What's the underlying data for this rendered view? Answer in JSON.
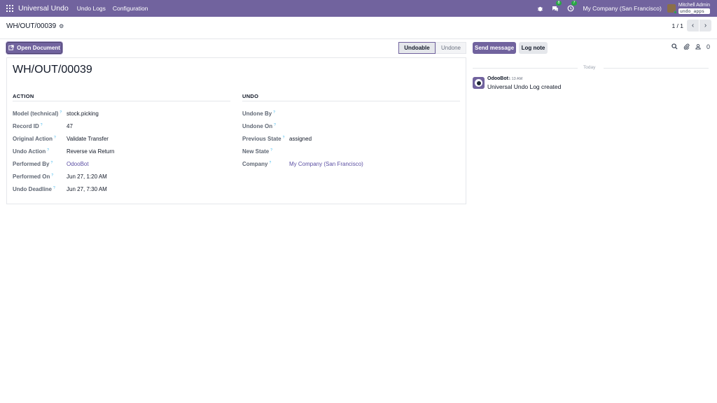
{
  "navbar": {
    "app_name": "Universal Undo",
    "menu": [
      "Undo Logs",
      "Configuration"
    ],
    "messages_count": "8",
    "activities_count": "7",
    "company": "My Company (San Francisco)",
    "user_name": "Mitchell Admin",
    "db_name": "undo_apps"
  },
  "control": {
    "breadcrumb": "WH/OUT/00039",
    "pager": "1 / 1"
  },
  "actions": {
    "open_document": "Open Document"
  },
  "status": {
    "stages": [
      "Undoable",
      "Undone"
    ],
    "current": "Undoable"
  },
  "record": {
    "title": "WH/OUT/00039",
    "action_group": {
      "title": "ACTION",
      "fields": [
        {
          "label": "Model (technical)",
          "value": "stock.picking"
        },
        {
          "label": "Record ID",
          "value": "47"
        },
        {
          "label": "Original Action",
          "value": "Validate Transfer"
        },
        {
          "label": "Undo Action",
          "value": "Reverse via Return"
        },
        {
          "label": "Performed By",
          "value": "OdooBot"
        },
        {
          "label": "Performed On",
          "value": "Jun 27, 1:20 AM"
        },
        {
          "label": "Undo Deadline",
          "value": "Jun 27, 7:30 AM"
        }
      ]
    },
    "undo_group": {
      "title": "UNDO",
      "fields": [
        {
          "label": "Undone By",
          "value": ""
        },
        {
          "label": "Undone On",
          "value": ""
        },
        {
          "label": "Previous State",
          "value": "assigned"
        },
        {
          "label": "New State",
          "value": ""
        },
        {
          "label": "Company",
          "value": "My Company (San Francisco)"
        }
      ]
    },
    "help_mark": "?"
  },
  "chatter": {
    "send_message": "Send message",
    "log_note": "Log note",
    "followers_count": "0",
    "date_separator": "Today",
    "message": {
      "author": "OdooBot",
      "time": "1:13 AM",
      "body": "Universal Undo Log created"
    }
  }
}
